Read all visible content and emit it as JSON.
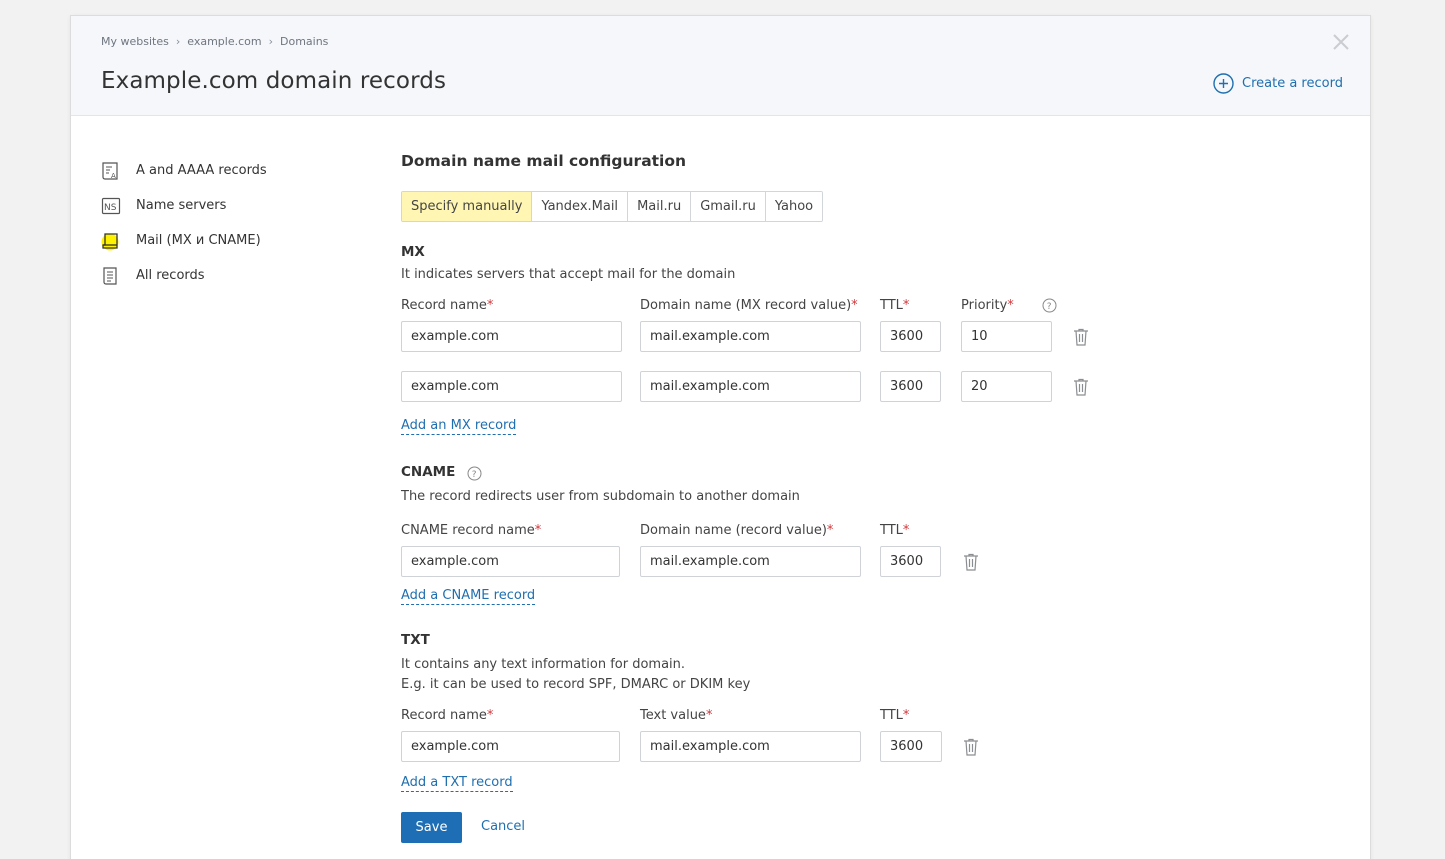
{
  "breadcrumb": [
    "My websites",
    "example.com",
    "Domains"
  ],
  "title": "Example.com domain records",
  "create_label": "Create a record",
  "sidebar": {
    "items": [
      {
        "label": "A and AAAA records",
        "icon": "a-record-icon"
      },
      {
        "label": "Name servers",
        "icon": "ns-icon"
      },
      {
        "label": "Mail (MX и CNAME)",
        "icon": "mail-icon"
      },
      {
        "label": "All records",
        "icon": "list-icon"
      }
    ]
  },
  "mail": {
    "title": "Domain name mail configuration",
    "tabs": [
      "Specify manually",
      "Yandex.Mail",
      "Mail.ru",
      "Gmail.ru",
      "Yahoo"
    ],
    "active_tab": "Specify manually"
  },
  "mx": {
    "title": "MX",
    "description": "It indicates servers that accept mail for the domain",
    "labels": {
      "name": "Record name",
      "value": "Domain name (MX record value)",
      "ttl": "TTL",
      "priority": "Priority"
    },
    "rows": [
      {
        "name": "example.com",
        "value": "mail.example.com",
        "ttl": "3600",
        "priority": "10"
      },
      {
        "name": "example.com",
        "value": "mail.example.com",
        "ttl": "3600",
        "priority": "20"
      }
    ],
    "add_label": "Add an MX record"
  },
  "cname": {
    "title": "CNAME",
    "description": "The record redirects user from subdomain to another domain",
    "labels": {
      "name": "CNAME record name",
      "value": "Domain name (record value)",
      "ttl": "TTL"
    },
    "rows": [
      {
        "name": "example.com",
        "value": "mail.example.com",
        "ttl": "3600"
      }
    ],
    "add_label": "Add a CNAME record"
  },
  "txt": {
    "title": "TXT",
    "description_line1": "It contains any text information for domain.",
    "description_line2": "E.g. it can be used to record SPF, DMARC or DKIM key",
    "labels": {
      "name": "Record name",
      "value": "Text value",
      "ttl": "TTL"
    },
    "rows": [
      {
        "name": "example.com",
        "value": "mail.example.com",
        "ttl": "3600"
      }
    ],
    "add_label": "Add a TXT record"
  },
  "actions": {
    "save": "Save",
    "cancel": "Cancel"
  },
  "colors": {
    "accent": "#1d6eb5",
    "active_tab": "#fff6b3",
    "required": "#d0373b",
    "highlight": "#fff200"
  },
  "required_mark": "*"
}
